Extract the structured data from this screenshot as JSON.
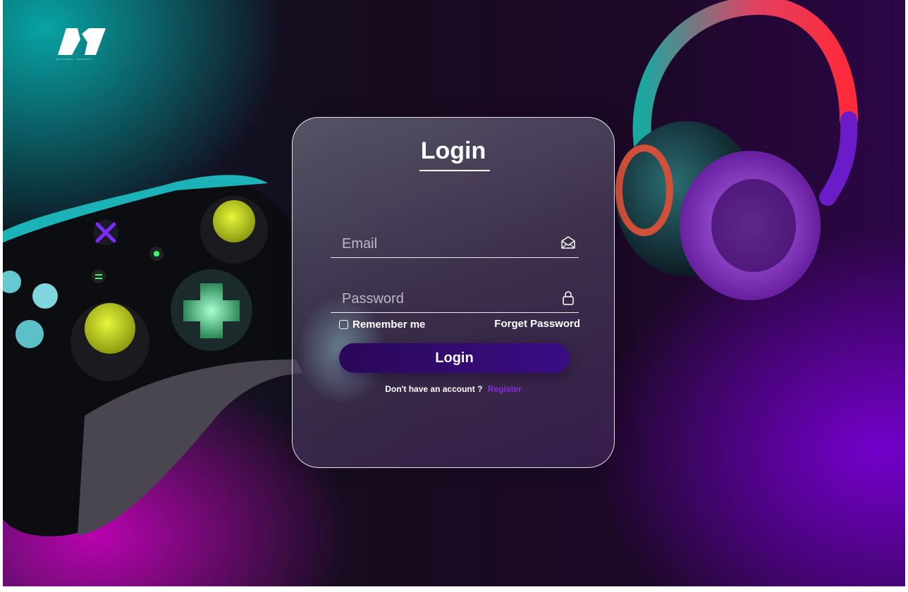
{
  "brand": {
    "logo_icon": "n-brand-logo-icon",
    "tagline": "NATIONAL ESPORTS"
  },
  "login_form": {
    "title": "Login",
    "email": {
      "placeholder": "Email",
      "value": "",
      "icon": "envelope-icon"
    },
    "password": {
      "placeholder": "Password",
      "value": "",
      "icon": "lock-icon"
    },
    "remember_label": "Remember me",
    "remember_checked": false,
    "forgot_label": "Forget Password",
    "submit_label": "Login",
    "register_prompt": "Don't have an account ?",
    "register_link": "Register"
  },
  "colors": {
    "button_start": "#2a0858",
    "button_end": "#3b0c86",
    "link": "#8a2be2",
    "teal_glow": "#08aaaa",
    "magenta_glow": "#d600c8",
    "purple_glow": "#7800d2"
  },
  "illustrations": {
    "left": "game-controller-illustration",
    "right": "headphones-illustration"
  }
}
